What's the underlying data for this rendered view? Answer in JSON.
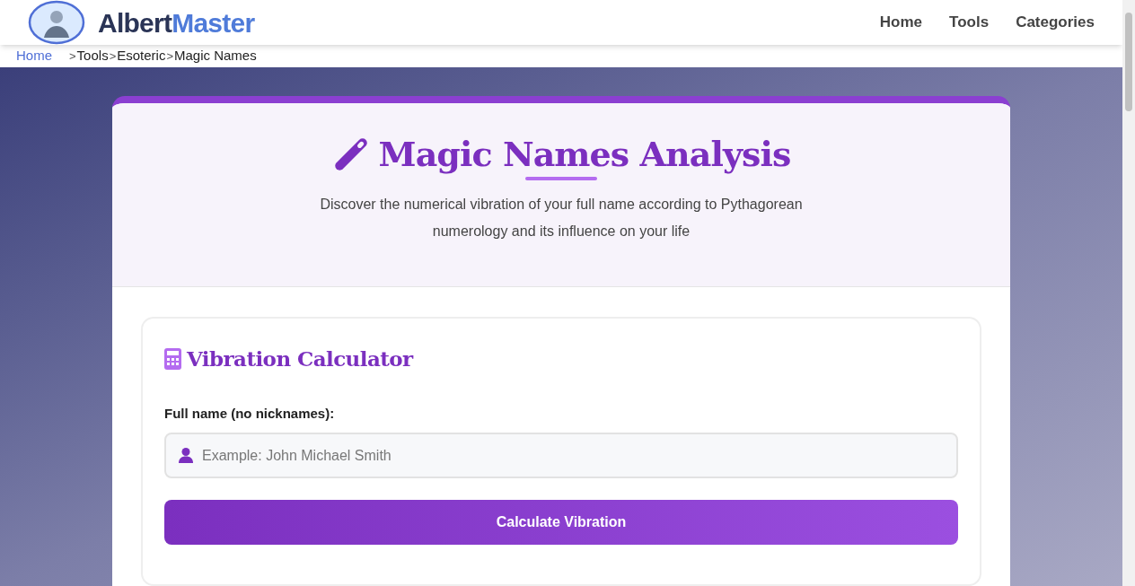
{
  "header": {
    "logo": {
      "text_dark": "Albert",
      "text_accent": "Master"
    },
    "nav": [
      {
        "label": "Home"
      },
      {
        "label": "Tools"
      },
      {
        "label": "Categories"
      }
    ]
  },
  "breadcrumb": [
    {
      "label": "Home",
      "kind": "link"
    },
    {
      "label": ">",
      "kind": "sep"
    },
    {
      "label": "Tools",
      "kind": "item"
    },
    {
      "label": ">",
      "kind": "sep"
    },
    {
      "label": "Esoteric",
      "kind": "item"
    },
    {
      "label": ">",
      "kind": "sep"
    },
    {
      "label": "Magic Names",
      "kind": "item"
    }
  ],
  "hero": {
    "title": "Magic Names Analysis",
    "subtitle": "Discover the numerical vibration of your full name according to Pythagorean numerology and its influence on your life"
  },
  "calculator": {
    "title": "Vibration Calculator",
    "field_label": "Full name (no nicknames):",
    "placeholder": "Example: John Michael Smith",
    "button": "Calculate Vibration"
  }
}
